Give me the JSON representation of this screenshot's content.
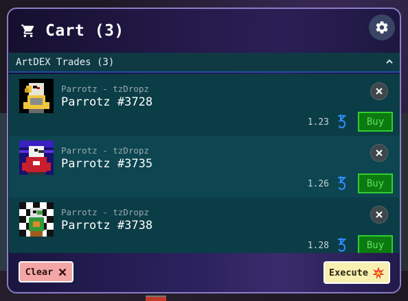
{
  "cart": {
    "title": "Cart (3)",
    "settings_icon": "gear-icon",
    "cart_icon": "shopping-cart-icon"
  },
  "section": {
    "title": "ArtDEX Trades (3)",
    "toggle_icon": "chevron-up-icon"
  },
  "items": [
    {
      "collection": "Parrotz - tzDropz",
      "name": "Parrotz #3728",
      "price": "1.23",
      "buy_label": "Buy",
      "thumb": "parrot-white-on-black"
    },
    {
      "collection": "Parrotz - tzDropz",
      "name": "Parrotz #3735",
      "price": "1.26",
      "buy_label": "Buy",
      "thumb": "parrot-on-purple-hoodie"
    },
    {
      "collection": "Parrotz - tzDropz",
      "name": "Parrotz #3738",
      "price": "1.28",
      "buy_label": "Buy",
      "thumb": "parrot-on-checkerboard"
    }
  ],
  "footer": {
    "clear_label": "Clear",
    "execute_label": "Execute"
  },
  "colors": {
    "accent_border": "#8a7fc7",
    "buy_green": "#2fd02f",
    "clear_bg": "#f4a6a6",
    "execute_bg": "#f8f0b0",
    "tez_blue": "#2f8cff"
  }
}
